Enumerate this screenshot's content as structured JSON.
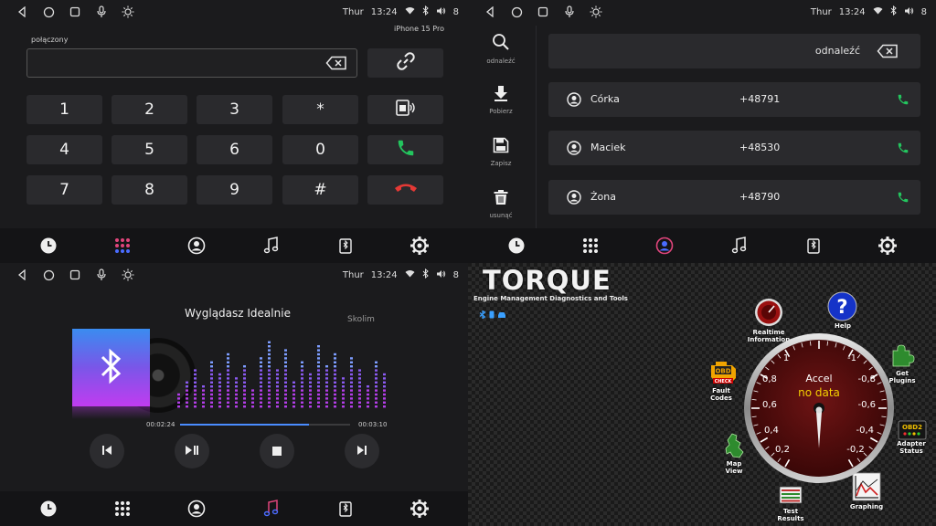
{
  "status": {
    "day": "Thur",
    "time": "13:24",
    "volume": "8"
  },
  "dialer": {
    "status_text": "połączony",
    "device_name": "iPhone 15 Pro",
    "input_value": "",
    "keys": [
      "1",
      "2",
      "3",
      "*",
      "4",
      "5",
      "6",
      "0",
      "7",
      "8",
      "9",
      "#"
    ]
  },
  "contacts": {
    "tools": [
      {
        "label": "odnaleźć",
        "icon": "search-icon"
      },
      {
        "label": "Pobierz",
        "icon": "download-icon"
      },
      {
        "label": "Zapisz",
        "icon": "save-icon"
      },
      {
        "label": "usunąć",
        "icon": "trash-icon"
      }
    ],
    "search_label": "odnaleźć",
    "list": [
      {
        "name": "Córka",
        "phone": "+48791"
      },
      {
        "name": "Maciek",
        "phone": "+48530"
      },
      {
        "name": "Żona",
        "phone": "+48790"
      }
    ]
  },
  "music": {
    "title": "Wyglądasz Idealnie",
    "artist": "Skolim",
    "current_time": "00:02:24",
    "total_time": "00:03:10",
    "progress": 0.758
  },
  "torque": {
    "title": "TORQUE",
    "subtitle": "Engine Management Diagnostics and Tools",
    "realtime": "Realtime\nInformation",
    "help": "Help",
    "get_plugins": "Get\nPlugins",
    "fault_codes": "Fault\nCodes",
    "obd_badge": "OBD",
    "check_engine": "CHECK",
    "adapter_status": "Adapter\nStatus",
    "obd2_badge": "OBD2",
    "map_view": "Map\nView",
    "test_results": "Test\nResults",
    "graphing": "Graphing",
    "gauge": {
      "label": "Accel",
      "value_text": "no data",
      "ticks": [
        "1",
        "-1",
        "0,8",
        "-0,8",
        "0,6",
        "-0,6",
        "0,4",
        "-0,4",
        "0,2",
        "-0,2"
      ]
    }
  },
  "colors": {
    "call_green": "#23c55e",
    "hangup_red": "#e53935",
    "accent_blue": "#4a8cff",
    "active_nav": "#e0457b"
  }
}
